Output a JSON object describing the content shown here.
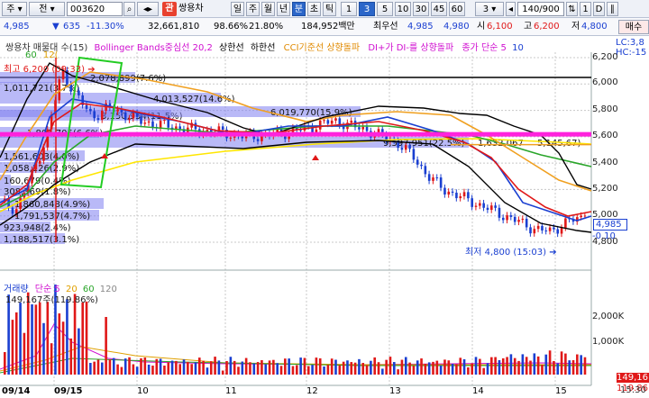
{
  "toolbar": {
    "menu_label": "주",
    "mode_label": "전",
    "code_value": "003620",
    "badge_label": "관",
    "stock_name": "쌍용차",
    "periods": [
      "일",
      "주",
      "월",
      "년",
      "분",
      "초",
      "틱"
    ],
    "active_period": "분",
    "intervals": [
      "1",
      "3",
      "5",
      "10",
      "30",
      "45",
      "60"
    ],
    "active_interval": "3",
    "interval_select": "3",
    "count_value": "140/900",
    "right_btn_1": "1",
    "right_btn_2": "D",
    "right_btn_3": "∥"
  },
  "quote": {
    "price": "4,985",
    "arrow": "▼",
    "change": "635",
    "change_pct": "-11.30%",
    "volume": "32,661,810",
    "ratio": "98.66%",
    "turnover": "21.80%",
    "amount": "184,952백만",
    "bid_label": "최우선",
    "best_ask": "4,985",
    "best_bid": "4,980",
    "open_label": "시",
    "open": "6,100",
    "high_label": "고",
    "high": "6,200",
    "low_label": "저",
    "low": "4,800",
    "order_label": "매수"
  },
  "price_legend": {
    "name": "쌍용차 매물대 수(15)",
    "bb": "Bollinger Bands중심선 20,2",
    "bb_upper": "상한선",
    "bb_lower": "하한선",
    "cci": "CCI기준선 상향돌파",
    "di": "DI+가 DI-를 상향돌파",
    "ma": "종가 단순 5",
    "ma_more": "10",
    "sub_1": "60",
    "sub_2": "12(",
    "right_1": "LC:3,8",
    "right_2": "HC:-15"
  },
  "y_axis": {
    "labels": [
      "6,200",
      "6,000",
      "5,800",
      "5,600",
      "5,400",
      "5,200",
      "5,000",
      "4,800"
    ],
    "current_price": "4,985",
    "current_change": "-0.10"
  },
  "annotations": {
    "high_label": "최고 6,200 (09:33)",
    "low_label": "최저 4,800 (15:03)"
  },
  "volume_profile": [
    {
      "label": "2,078,899(7.6%)"
    },
    {
      "label": "1,011,721(3.7%)"
    },
    {
      "label": "4,013,527(14.6%)"
    },
    {
      "label": "3,150,954(11.5%)"
    },
    {
      "label": "6,019,770(15.9%)"
    },
    {
      "label": "1,803,705(6.6%)"
    },
    {
      "label": "9,597,951(22.5%)"
    },
    {
      "label": "1,632,067"
    },
    {
      "label": "5,145,67)"
    },
    {
      "label": "1,561,603(4.0%)"
    },
    {
      "label": "1,058,126(2.9%)"
    },
    {
      "label": "160,679(0.4%)"
    },
    {
      "label": "308,369(1.8%)"
    },
    {
      "label": "1,860,848(4.9%)"
    },
    {
      "label": "1,791,537(4.7%)"
    },
    {
      "label": "923,948(2.4%)"
    },
    {
      "label": "1,188,517(3.1%)"
    }
  ],
  "volume_legend": {
    "title": "거래량",
    "ma_label": "단순",
    "ma_5": "5",
    "ma_20": "20",
    "ma_60": "60",
    "ma_120": "120",
    "last_value": "149,167주(119.86%)"
  },
  "volume_axis": {
    "labels": [
      "2,000K",
      "1,000K"
    ],
    "current": "149,16",
    "current_pct": "119.86"
  },
  "x_axis": {
    "labels": [
      "09/14",
      "09/15",
      "10",
      "11",
      "12",
      "13",
      "14",
      "15"
    ],
    "corner": "15:30"
  },
  "colors": {
    "up": "#e01818",
    "down": "#1a3fd1",
    "bb_band": "#000000",
    "bb_mid": "#2aa52a",
    "ma5": "#1a3fd1",
    "ma10": "#e01818",
    "ma20": "#f0a020",
    "ma60": "#ffe600",
    "magenta": "#ff22dd",
    "profile": "#8080f0"
  }
}
